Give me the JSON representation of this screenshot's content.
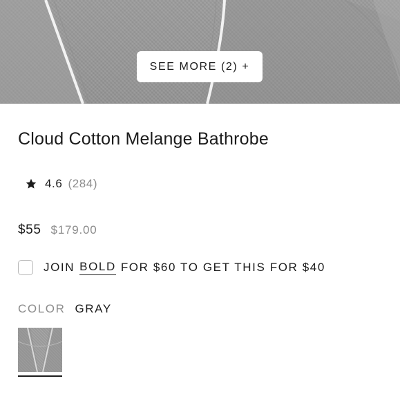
{
  "hero": {
    "see_more_label": "SEE MORE (2) +"
  },
  "product": {
    "title": "Cloud Cotton Melange Bathrobe",
    "rating": "4.6",
    "review_count": "(284)",
    "price": "$55",
    "original_price": "$179.00"
  },
  "membership_offer": {
    "prefix": "JOIN",
    "link_label": "BOLD",
    "suffix": "FOR $60 TO GET THIS FOR $40",
    "checked": false
  },
  "color": {
    "label": "COLOR",
    "selected": "GRAY"
  },
  "icons": {
    "rating": "star-icon"
  },
  "colors": {
    "text": "#1c1c1c",
    "muted": "#8c8c8c",
    "hero_fabric": "#9a9a9a"
  }
}
